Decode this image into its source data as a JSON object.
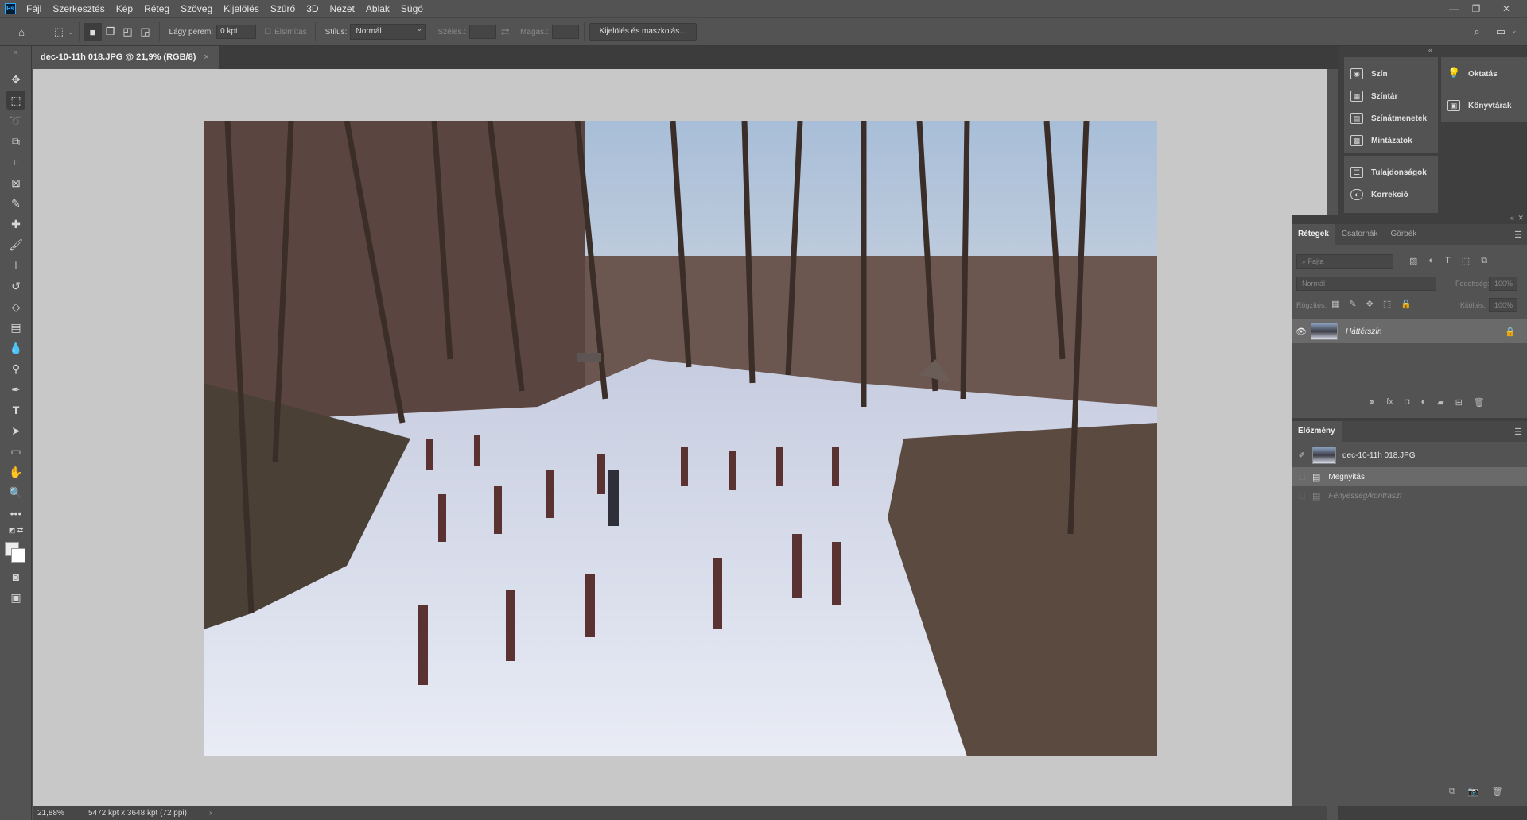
{
  "menubar": {
    "logo": "Ps",
    "items": [
      "Fájl",
      "Szerkesztés",
      "Kép",
      "Réteg",
      "Szöveg",
      "Kijelölés",
      "Szűrő",
      "3D",
      "Nézet",
      "Ablak",
      "Súgó"
    ]
  },
  "options": {
    "feather_label": "Lágy perem:",
    "feather_value": "0 kpt",
    "antialias_label": "Élsimítás",
    "style_label": "Stílus:",
    "style_value": "Normál",
    "width_label": "Széles.:",
    "height_label": "Magas.:",
    "select_mask_button": "Kijelölés és maszkolás..."
  },
  "document": {
    "tab_title": "dec-10-11h 018.JPG @ 21,9% (RGB/8)",
    "close": "×"
  },
  "status": {
    "zoom": "21,88%",
    "dimensions": "5472 kpt x 3648 kpt (72 ppi)",
    "arrow": "›"
  },
  "panels_top": {
    "col1": [
      "Szín",
      "Színtár",
      "Színátmenetek",
      "Mintázatok",
      "Tulajdonságok",
      "Korrekció"
    ],
    "col2": [
      "Oktatás",
      "Könyvtárak"
    ]
  },
  "layers_panel": {
    "tabs": [
      "Rétegek",
      "Csatornák",
      "Görbék"
    ],
    "search_placeholder": "Fajta",
    "blend_mode": "Normál",
    "opacity_label": "Fedettség:",
    "opacity_value": "100%",
    "lock_label": "Rögzítés:",
    "fill_label": "Kitöltés:",
    "fill_value": "100%",
    "layer_name": "Háttérszín"
  },
  "history_panel": {
    "tab": "Előzmény",
    "snapshot": "dec-10-11h 018.JPG",
    "items": [
      "Megnyitás",
      "Fényesség/kontraszt"
    ]
  }
}
